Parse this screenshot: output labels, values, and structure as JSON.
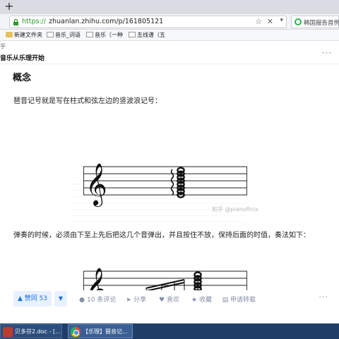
{
  "browser": {
    "new_tab": "+",
    "url_scheme": "https://",
    "url_rest": "zhuanlan.zhihu.com/p/161805121",
    "search_text": "韩国报告首例"
  },
  "bookmarks": [
    {
      "label": "新建文件夹",
      "icon": "folder-icon"
    },
    {
      "label": "音乐_词语",
      "icon": "page-icon"
    },
    {
      "label": "音乐（一种",
      "icon": "page-icon"
    },
    {
      "label": "五线谱（五",
      "icon": "page-icon"
    }
  ],
  "header": {
    "cut_text": "乎",
    "column_title": "音乐从乐理开始",
    "more": "···"
  },
  "article": {
    "section_title": "概念",
    "para1": "琶音记号就是写在柱式和弦左边的竖波浪记号：",
    "watermark": "知乎 @pianofinix",
    "para2": "弹奏的时候，必须由下至上先后把这几个音弹出，并且按住不放，保持后面的时值，奏法如下："
  },
  "actions": {
    "vote_up": "▲ 赞同 53",
    "vote_down": "▼",
    "comments": "10 条评论",
    "share": "分享",
    "like": "喜欢",
    "favorite": "收藏",
    "reprint": "申请转载",
    "more": "···"
  },
  "taskbar": {
    "item1": "贝多芬2.doc - [...",
    "item2": "【乐理】琶音记..."
  }
}
